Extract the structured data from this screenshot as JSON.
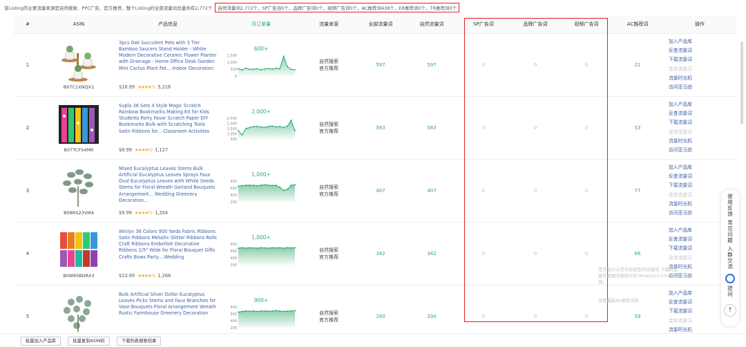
{
  "top": {
    "summary": "该Listing的主要流量来源是自然搜索、PPC广告、官方推荐，整个Listing的全部流量词总量共有2,772个",
    "highlight": "自然流量词2,772个，SP广告词0个，品牌广告词0个，视频广告词0个，AC推荐词438个，ER推荐词0个，TR推荐词0个"
  },
  "columns": {
    "index": "#",
    "asin": "ASIN",
    "product": "产品信息",
    "monthly_sales": "月订单量",
    "source": "流量来源",
    "all_keywords": "全部流量词",
    "organic_keywords": "自然流量词",
    "sp_ads": "SP广告词",
    "brand_ads": "品牌广告词",
    "video_ads": "视频广告词",
    "ac_keywords": "AC推荐词",
    "actions": "操作"
  },
  "rows": [
    {
      "index": "1",
      "asin": "B07C1XNQX1",
      "title": "3pcs Owl Succulent Pots with 3 Tier Bamboo Saucers Stand Holder - White Modern Decorative Ceramic Flower Planter with Drainage - Home Office Desk Garden Mini Cactus Plant Pot... Indoor Decoration",
      "price": "$18.99",
      "stars": "★★★★½",
      "reviews": "5,216",
      "peak": "600+",
      "y_ticks": [
        "1,500",
        "1,000",
        "500",
        "0"
      ],
      "trend": [
        0.35,
        0.3,
        0.38,
        0.32,
        0.33,
        0.35,
        0.3,
        0.34,
        0.36,
        0.33,
        0.38,
        0.35,
        0.95,
        0.45,
        0.32,
        0.3
      ],
      "source_line1": "自然搜索",
      "source_line2": "官方推荐",
      "all_keywords": "597",
      "organic_keywords": "597",
      "sp_ads": "0",
      "brand_ads": "0",
      "video_ads": "0",
      "ac_keywords": "22"
    },
    {
      "index": "2",
      "asin": "B07TCFS4MR",
      "title": "Supla 36 Sets 4 Style Magic Scratch Rainbow Bookmarks Making Kit for Kids Students Party Favor Scratch Paper DIY Bookmarks Bulk with Scratching Tools Satin Ribbons for... Classroom Activities",
      "price": "$8.99",
      "stars": "★★★★½",
      "reviews": "1,127",
      "peak": "2,000+",
      "y_ticks": [
        "2,500",
        "2,000",
        "1,500",
        "1,000",
        "500"
      ],
      "trend": [
        0.4,
        0.2,
        0.5,
        0.55,
        0.6,
        0.6,
        0.58,
        0.55,
        0.6,
        0.62,
        0.58,
        0.6,
        0.55,
        0.62,
        0.9,
        0.4
      ],
      "source_line1": "自然搜索",
      "source_line2": "官方推荐",
      "all_keywords": "583",
      "organic_keywords": "583",
      "sp_ads": "0",
      "brand_ads": "0",
      "video_ads": "0",
      "ac_keywords": "53"
    },
    {
      "index": "3",
      "asin": "B08RS23VM4",
      "title": "Mixed Eucalyptus Leaves Stems Bulk Artificial Eucalyptus Leaves Sprays Faux Oval Eucalyptus Leaves with White Seeds Stems for Floral Wreath Garland Bouquets Arrangement... Wedding Greenery Decoration...",
      "price": "$9.99",
      "stars": "★★★★½",
      "reviews": "1,204",
      "peak": "1,000+",
      "y_ticks": [
        "800",
        "600",
        "400",
        "200"
      ],
      "trend": [
        0.75,
        0.78,
        0.8,
        0.8,
        0.8,
        0.78,
        0.8,
        0.82,
        0.8,
        0.79,
        0.8,
        0.7,
        0.55,
        0.6,
        0.8,
        0.82
      ],
      "source_line1": "自然搜索",
      "source_line2": "官方推荐",
      "all_keywords": "407",
      "organic_keywords": "407",
      "sp_ads": "0",
      "brand_ads": "0",
      "video_ads": "0",
      "ac_keywords": "77"
    },
    {
      "index": "4",
      "asin": "B08M3BDRX3",
      "title": "Winlyn 36 Colors 900 Yards Fabric Ribbons Satin Ribbons Metallic Glitter Ribbons Rolls Craft Ribbons Embellish Decorative Ribbons 2/5\" Wide for Floral Bouquet Gifts Crafts Bows Party... Wedding",
      "price": "$13.99",
      "stars": "★★★★½",
      "reviews": "1,268",
      "peak": "1,000+",
      "y_ticks": [
        "800",
        "600",
        "400",
        "200"
      ],
      "trend": [
        0.8,
        0.82,
        0.8,
        0.82,
        0.81,
        0.8,
        0.82,
        0.81,
        0.8,
        0.82,
        0.81,
        0.82,
        0.8,
        0.82,
        0.81,
        0.82
      ],
      "source_line1": "自然搜索",
      "source_line2": "官方推荐",
      "all_keywords": "342",
      "organic_keywords": "342",
      "sp_ads": "0",
      "brand_ads": "0",
      "video_ads": "0",
      "ac_keywords": "66"
    },
    {
      "index": "5",
      "asin": "",
      "title": "Bulk Artificial Silver Dollar Eucalyptus Leaves Picks Stems and Faux Branches for Vase Bouquets Floral Arrangement Wreath Rustic Farmhouse Greenery Decoration",
      "price": "",
      "stars": "",
      "reviews": "",
      "peak": "900+",
      "y_ticks": [
        "800",
        "600",
        "400",
        "200"
      ],
      "trend": [
        0.75,
        0.78,
        0.8,
        0.79,
        0.8,
        0.78,
        0.8,
        0.8,
        0.79,
        0.8,
        0.82,
        0.8,
        0.78,
        0.8,
        0.8,
        0.82
      ],
      "source_line1": "自然搜索",
      "source_line2": "官方推荐",
      "all_keywords": "290",
      "organic_keywords": "290",
      "sp_ads": "0",
      "brand_ads": "0",
      "video_ads": "0",
      "ac_keywords": "59"
    }
  ],
  "actions": {
    "add_to_library": "加入产品库",
    "reverse_lookup": "反查流量词",
    "download_keywords": "下载流量词",
    "variant_keywords": "变体流量词",
    "traffic_time_machine": "流量时光机",
    "visit_amazon": "访问亚马逊"
  },
  "bottom": {
    "batch_add": "批量加入产品库",
    "batch_copy_asin": "批量复制ASIN码",
    "download_list": "下载列表搜索结果"
  },
  "side": {
    "feedback": "使用反馈",
    "faq": "常见问题",
    "join_group": "入群交流",
    "ask": "提问"
  },
  "ghost": {
    "line1": "是否显示示范与热衷型的关键词 下载商品推荐数据结果统计的 Amazon's Choice内容。",
    "line2": "查看最新AC推荐词条"
  }
}
